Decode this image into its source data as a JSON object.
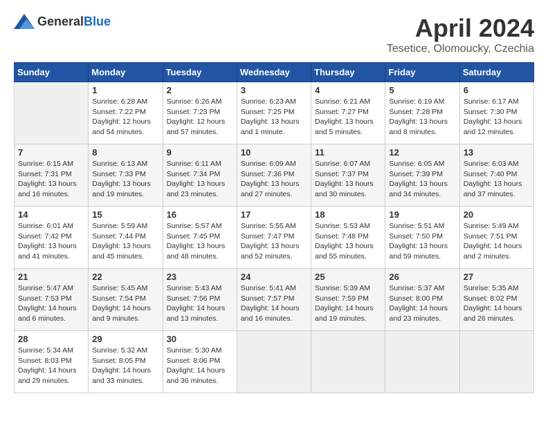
{
  "header": {
    "logo_general": "General",
    "logo_blue": "Blue",
    "month_year": "April 2024",
    "location": "Tesetice, Olomoucky, Czechia"
  },
  "calendar": {
    "days_of_week": [
      "Sunday",
      "Monday",
      "Tuesday",
      "Wednesday",
      "Thursday",
      "Friday",
      "Saturday"
    ],
    "weeks": [
      [
        {
          "day": "",
          "info": ""
        },
        {
          "day": "1",
          "info": "Sunrise: 6:28 AM\nSunset: 7:22 PM\nDaylight: 12 hours\nand 54 minutes."
        },
        {
          "day": "2",
          "info": "Sunrise: 6:26 AM\nSunset: 7:23 PM\nDaylight: 12 hours\nand 57 minutes."
        },
        {
          "day": "3",
          "info": "Sunrise: 6:23 AM\nSunset: 7:25 PM\nDaylight: 13 hours\nand 1 minute."
        },
        {
          "day": "4",
          "info": "Sunrise: 6:21 AM\nSunset: 7:27 PM\nDaylight: 13 hours\nand 5 minutes."
        },
        {
          "day": "5",
          "info": "Sunrise: 6:19 AM\nSunset: 7:28 PM\nDaylight: 13 hours\nand 8 minutes."
        },
        {
          "day": "6",
          "info": "Sunrise: 6:17 AM\nSunset: 7:30 PM\nDaylight: 13 hours\nand 12 minutes."
        }
      ],
      [
        {
          "day": "7",
          "info": "Sunrise: 6:15 AM\nSunset: 7:31 PM\nDaylight: 13 hours\nand 16 minutes."
        },
        {
          "day": "8",
          "info": "Sunrise: 6:13 AM\nSunset: 7:33 PM\nDaylight: 13 hours\nand 19 minutes."
        },
        {
          "day": "9",
          "info": "Sunrise: 6:11 AM\nSunset: 7:34 PM\nDaylight: 13 hours\nand 23 minutes."
        },
        {
          "day": "10",
          "info": "Sunrise: 6:09 AM\nSunset: 7:36 PM\nDaylight: 13 hours\nand 27 minutes."
        },
        {
          "day": "11",
          "info": "Sunrise: 6:07 AM\nSunset: 7:37 PM\nDaylight: 13 hours\nand 30 minutes."
        },
        {
          "day": "12",
          "info": "Sunrise: 6:05 AM\nSunset: 7:39 PM\nDaylight: 13 hours\nand 34 minutes."
        },
        {
          "day": "13",
          "info": "Sunrise: 6:03 AM\nSunset: 7:40 PM\nDaylight: 13 hours\nand 37 minutes."
        }
      ],
      [
        {
          "day": "14",
          "info": "Sunrise: 6:01 AM\nSunset: 7:42 PM\nDaylight: 13 hours\nand 41 minutes."
        },
        {
          "day": "15",
          "info": "Sunrise: 5:59 AM\nSunset: 7:44 PM\nDaylight: 13 hours\nand 45 minutes."
        },
        {
          "day": "16",
          "info": "Sunrise: 5:57 AM\nSunset: 7:45 PM\nDaylight: 13 hours\nand 48 minutes."
        },
        {
          "day": "17",
          "info": "Sunrise: 5:55 AM\nSunset: 7:47 PM\nDaylight: 13 hours\nand 52 minutes."
        },
        {
          "day": "18",
          "info": "Sunrise: 5:53 AM\nSunset: 7:48 PM\nDaylight: 13 hours\nand 55 minutes."
        },
        {
          "day": "19",
          "info": "Sunrise: 5:51 AM\nSunset: 7:50 PM\nDaylight: 13 hours\nand 59 minutes."
        },
        {
          "day": "20",
          "info": "Sunrise: 5:49 AM\nSunset: 7:51 PM\nDaylight: 14 hours\nand 2 minutes."
        }
      ],
      [
        {
          "day": "21",
          "info": "Sunrise: 5:47 AM\nSunset: 7:53 PM\nDaylight: 14 hours\nand 6 minutes."
        },
        {
          "day": "22",
          "info": "Sunrise: 5:45 AM\nSunset: 7:54 PM\nDaylight: 14 hours\nand 9 minutes."
        },
        {
          "day": "23",
          "info": "Sunrise: 5:43 AM\nSunset: 7:56 PM\nDaylight: 14 hours\nand 13 minutes."
        },
        {
          "day": "24",
          "info": "Sunrise: 5:41 AM\nSunset: 7:57 PM\nDaylight: 14 hours\nand 16 minutes."
        },
        {
          "day": "25",
          "info": "Sunrise: 5:39 AM\nSunset: 7:59 PM\nDaylight: 14 hours\nand 19 minutes."
        },
        {
          "day": "26",
          "info": "Sunrise: 5:37 AM\nSunset: 8:00 PM\nDaylight: 14 hours\nand 23 minutes."
        },
        {
          "day": "27",
          "info": "Sunrise: 5:35 AM\nSunset: 8:02 PM\nDaylight: 14 hours\nand 26 minutes."
        }
      ],
      [
        {
          "day": "28",
          "info": "Sunrise: 5:34 AM\nSunset: 8:03 PM\nDaylight: 14 hours\nand 29 minutes."
        },
        {
          "day": "29",
          "info": "Sunrise: 5:32 AM\nSunset: 8:05 PM\nDaylight: 14 hours\nand 33 minutes."
        },
        {
          "day": "30",
          "info": "Sunrise: 5:30 AM\nSunset: 8:06 PM\nDaylight: 14 hours\nand 36 minutes."
        },
        {
          "day": "",
          "info": ""
        },
        {
          "day": "",
          "info": ""
        },
        {
          "day": "",
          "info": ""
        },
        {
          "day": "",
          "info": ""
        }
      ]
    ]
  }
}
